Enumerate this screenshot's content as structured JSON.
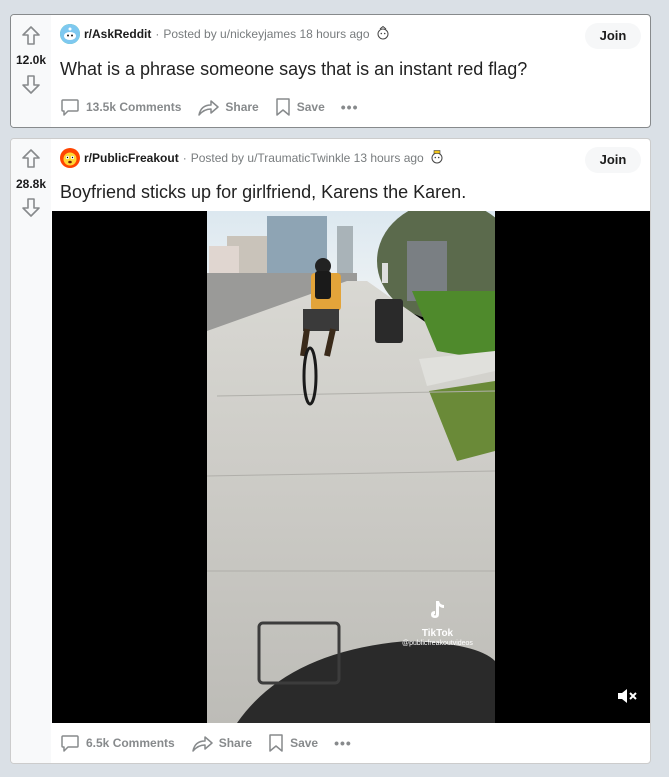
{
  "posts": [
    {
      "votes": "12.0k",
      "subreddit": "r/AskReddit",
      "posted_by": "Posted by u/nickeyjames",
      "time": "18 hours ago",
      "join": "Join",
      "title": "What is a phrase someone says that is an instant red flag?",
      "comments": "13.5k Comments",
      "share": "Share",
      "save": "Save"
    },
    {
      "votes": "28.8k",
      "subreddit": "r/PublicFreakout",
      "posted_by": "Posted by u/TraumaticTwinkle",
      "time": "13 hours ago",
      "join": "Join",
      "title": "Boyfriend sticks up for girlfriend, Karens the Karen.",
      "comments": "6.5k Comments",
      "share": "Share",
      "save": "Save",
      "video": {
        "watermark_brand": "TikTok",
        "watermark_handle": "@publicfreakoutvideos"
      }
    }
  ],
  "colors": {
    "page_bg": "#dae0e6",
    "askreddit_icon": "#46d160",
    "publicfreakout_icon": "#ff4500",
    "meta_text": "#787c7e",
    "action_text": "#878a8c"
  },
  "icons": [
    "upvote-icon",
    "downvote-icon",
    "comment-icon",
    "share-icon",
    "save-icon",
    "award-icon",
    "mute-icon",
    "tiktok-icon"
  ]
}
